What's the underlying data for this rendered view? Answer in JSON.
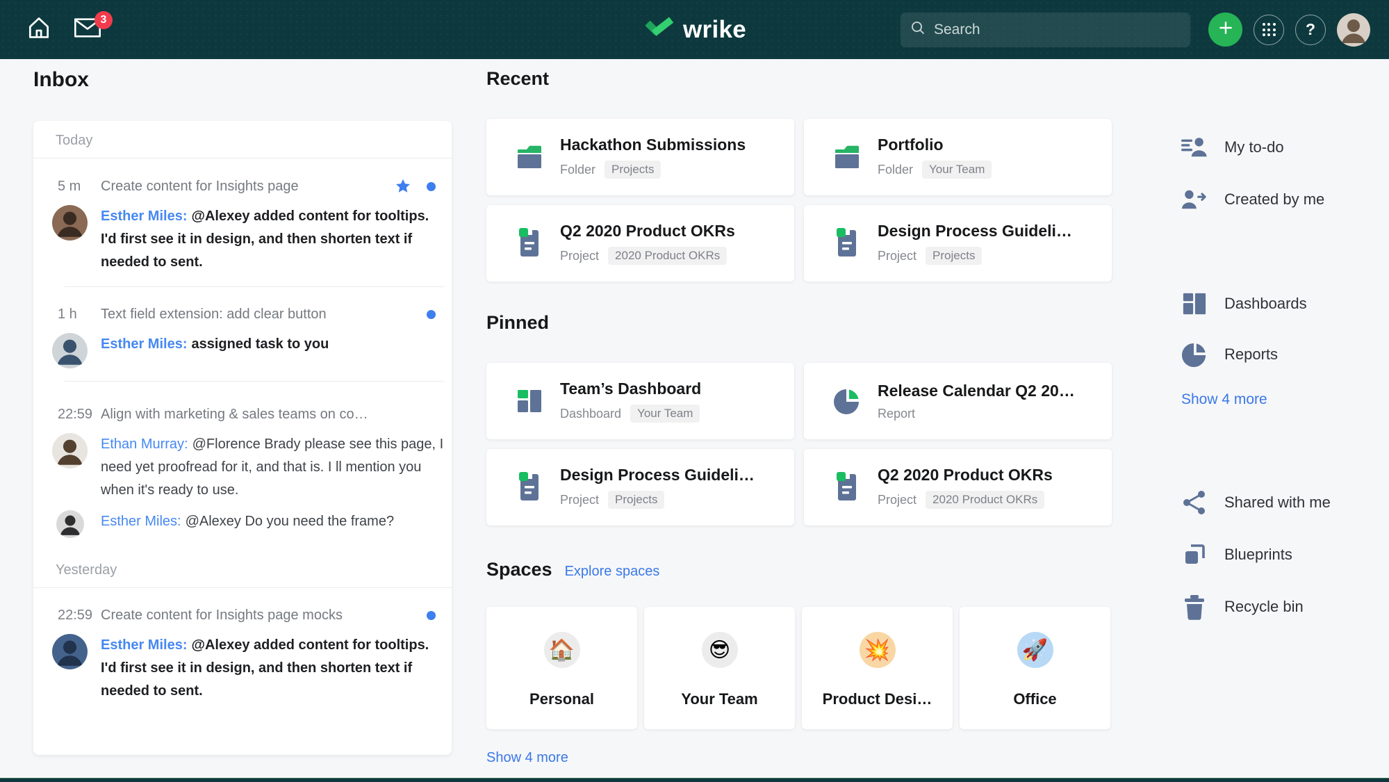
{
  "colors": {
    "navbar_teal": "#0d393e",
    "accent_green": "#26b456",
    "slate_icon": "#5d7296",
    "icon_green": "#19bd62",
    "link_blue": "#3a78e8",
    "badge_red": "#f23b4d",
    "unread_blue": "#3d7ef0"
  },
  "navbar": {
    "logo_text": "wrike",
    "inbox_badge": "3",
    "search_placeholder": "Search",
    "icons": [
      "home-icon",
      "inbox-envelope-icon",
      "search-icon",
      "add-plus-icon",
      "apps-grid-icon",
      "help-icon",
      "user-avatar"
    ]
  },
  "inbox": {
    "title": "Inbox",
    "groups": [
      {
        "label": "Today",
        "items": [
          {
            "time": "5 m",
            "title": "Create content for Insights page",
            "starred": true,
            "unread": true,
            "messages": [
              {
                "author": "Esther Miles:",
                "text": "@Alexey added content for tooltips. I'd first see it in design, and then shorten text if needed to sent."
              }
            ]
          },
          {
            "time": "1 h",
            "title": "Text field extension: add clear button",
            "starred": false,
            "unread": true,
            "messages": [
              {
                "author": "Esther Miles:",
                "text": "assigned task to you"
              }
            ]
          },
          {
            "time": "22:59",
            "title": "Align with marketing & sales teams on co…",
            "starred": false,
            "unread": false,
            "messages": [
              {
                "author": "Ethan Murray:",
                "text": "@Florence Brady please see this page, I need yet proofread for it, and that is. I ll mention you when it's ready to use."
              },
              {
                "author": "Esther Miles:",
                "text": "@Alexey Do you need the frame?"
              }
            ]
          }
        ]
      },
      {
        "label": "Yesterday",
        "items": [
          {
            "time": "22:59",
            "title": "Create content for Insights page mocks",
            "starred": false,
            "unread": true,
            "messages": [
              {
                "author": "Esther Miles:",
                "text": "@Alexey added content for tooltips. I'd first see it in design, and then shorten text if needed to sent."
              }
            ]
          }
        ]
      }
    ]
  },
  "recent": {
    "title": "Recent",
    "cards": [
      {
        "title": "Hackathon Submissions",
        "type": "Folder",
        "tag": "Projects",
        "icon": "folder-icon"
      },
      {
        "title": "Portfolio",
        "type": "Folder",
        "tag": "Your Team",
        "icon": "folder-icon"
      },
      {
        "title": "Q2 2020 Product OKRs",
        "type": "Project",
        "tag": "2020 Product OKRs",
        "icon": "project-icon"
      },
      {
        "title": "Design Process Guideli…",
        "type": "Project",
        "tag": "Projects",
        "icon": "project-icon"
      }
    ]
  },
  "pinned": {
    "title": "Pinned",
    "cards": [
      {
        "title": "Team’s Dashboard",
        "type": "Dashboard",
        "tag": "Your Team",
        "icon": "dashboard-icon"
      },
      {
        "title": "Release Calendar Q2 20…",
        "type": "Report",
        "tag": "",
        "icon": "report-pie-icon"
      },
      {
        "title": "Design Process Guideli…",
        "type": "Project",
        "tag": "Projects",
        "icon": "project-icon"
      },
      {
        "title": "Q2 2020 Product OKRs",
        "type": "Project",
        "tag": "2020 Product OKRs",
        "icon": "project-icon"
      }
    ]
  },
  "spaces": {
    "title": "Spaces",
    "explore_link": "Explore spaces",
    "show_more": "Show 4 more",
    "cards": [
      {
        "label": "Personal",
        "emoji": "🏠",
        "icon": "house-emoji"
      },
      {
        "label": "Your Team",
        "emoji": "😎",
        "icon": "sunglasses-emoji"
      },
      {
        "label": "Product Desi…",
        "emoji": "💥",
        "icon": "collision-emoji"
      },
      {
        "label": "Office",
        "emoji": "🚀",
        "icon": "rocket-emoji"
      }
    ]
  },
  "sidebar": {
    "items": [
      {
        "label": "My to-do",
        "icon": "my-todo-icon"
      },
      {
        "label": "Created by me",
        "icon": "created-by-me-icon"
      },
      {
        "label": "Dashboards",
        "icon": "dashboards-icon"
      },
      {
        "label": "Reports",
        "icon": "reports-icon"
      },
      {
        "label": "Show 4 more",
        "icon": ""
      },
      {
        "label": "Shared with me",
        "icon": "shared-with-me-icon"
      },
      {
        "label": "Blueprints",
        "icon": "blueprints-icon"
      },
      {
        "label": "Recycle bin",
        "icon": "recycle-bin-icon"
      }
    ]
  }
}
